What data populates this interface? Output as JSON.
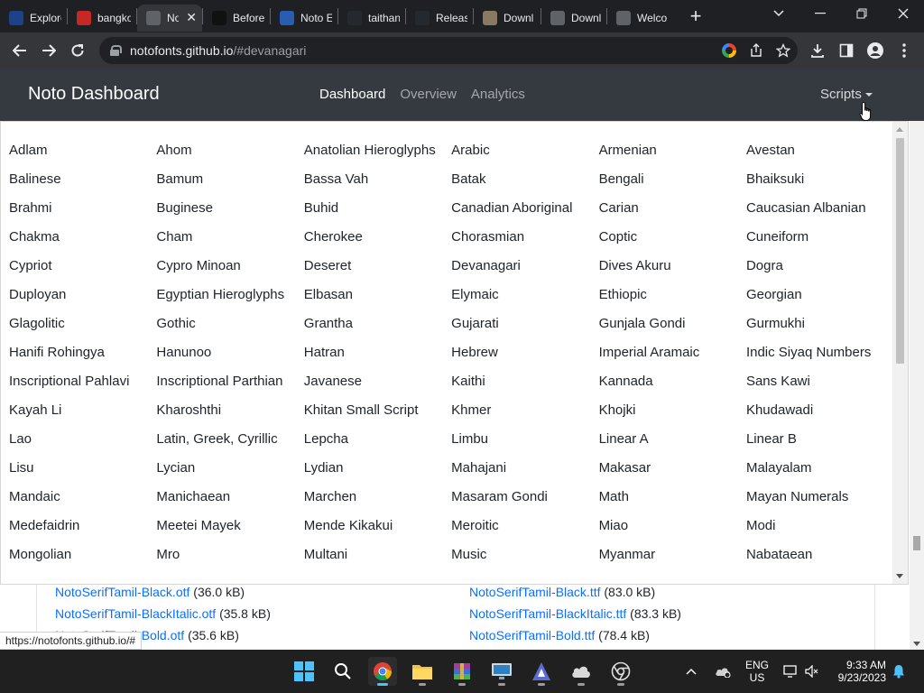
{
  "browser": {
    "tabs": [
      {
        "label": "Explore",
        "favicon": "vmware-icon",
        "color": "#1d428a"
      },
      {
        "label": "bangkok",
        "favicon": "bookmark-icon",
        "color": "#c62828"
      },
      {
        "label": "Noto",
        "favicon": "globe-icon",
        "color": "#5f6368",
        "active": true
      },
      {
        "label": "Before",
        "favicon": "shield-icon",
        "color": "#111111"
      },
      {
        "label": "Noto E",
        "favicon": "yahoo-icon",
        "color": "#2a5db0"
      },
      {
        "label": "taithan",
        "favicon": "github-icon",
        "color": "#24292f"
      },
      {
        "label": "Release",
        "favicon": "github-icon",
        "color": "#24292f"
      },
      {
        "label": "Downl",
        "favicon": "cloud-icon",
        "color": "#8a7a63"
      },
      {
        "label": "Downl",
        "favicon": "globe-icon",
        "color": "#5f6368"
      },
      {
        "label": "Welco",
        "favicon": "globe-icon",
        "color": "#5f6368"
      }
    ],
    "url_host": "notofonts.github.io",
    "url_path": "/#devanagari",
    "status_url": "https://notofonts.github.io/#"
  },
  "site": {
    "brand": "Noto Dashboard",
    "nav": [
      "Dashboard",
      "Overview",
      "Analytics"
    ],
    "active_nav": "Dashboard",
    "scripts_label": "Scripts"
  },
  "scripts": [
    "Adlam",
    "Ahom",
    "Anatolian Hieroglyphs",
    "Arabic",
    "Armenian",
    "Avestan",
    "Balinese",
    "Bamum",
    "Bassa Vah",
    "Batak",
    "Bengali",
    "Bhaiksuki",
    "Brahmi",
    "Buginese",
    "Buhid",
    "Canadian Aboriginal",
    "Carian",
    "Caucasian Albanian",
    "Chakma",
    "Cham",
    "Cherokee",
    "Chorasmian",
    "Coptic",
    "Cuneiform",
    "Cypriot",
    "Cypro Minoan",
    "Deseret",
    "Devanagari",
    "Dives Akuru",
    "Dogra",
    "Duployan",
    "Egyptian Hieroglyphs",
    "Elbasan",
    "Elymaic",
    "Ethiopic",
    "Georgian",
    "Glagolitic",
    "Gothic",
    "Grantha",
    "Gujarati",
    "Gunjala Gondi",
    "Gurmukhi",
    "Hanifi Rohingya",
    "Hanunoo",
    "Hatran",
    "Hebrew",
    "Imperial Aramaic",
    "Indic Siyaq Numbers",
    "Inscriptional Pahlavi",
    "Inscriptional Parthian",
    "Javanese",
    "Kaithi",
    "Kannada",
    "Sans Kawi",
    "Kayah Li",
    "Kharoshthi",
    "Khitan Small Script",
    "Khmer",
    "Khojki",
    "Khudawadi",
    "Lao",
    "Latin, Greek, Cyrillic",
    "Lepcha",
    "Limbu",
    "Linear A",
    "Linear B",
    "Lisu",
    "Lycian",
    "Lydian",
    "Mahajani",
    "Makasar",
    "Malayalam",
    "Mandaic",
    "Manichaean",
    "Marchen",
    "Masaram Gondi",
    "Math",
    "Mayan Numerals",
    "Medefaidrin",
    "Meetei Mayek",
    "Mende Kikakui",
    "Meroitic",
    "Miao",
    "Modi",
    "Mongolian",
    "Mro",
    "Multani",
    "Music",
    "Myanmar",
    "Nabataean"
  ],
  "files": [
    {
      "otf": "NotoSerifTamil-Black.otf",
      "otf_size": "(36.0 kB)",
      "ttf": "NotoSerifTamil-Black.ttf",
      "ttf_size": "(83.0 kB)"
    },
    {
      "otf": "NotoSerifTamil-BlackItalic.otf",
      "otf_size": "(35.8 kB)",
      "ttf": "NotoSerifTamil-BlackItalic.ttf",
      "ttf_size": "(83.3 kB)"
    },
    {
      "otf": "NotoSerifTamil-Bold.otf",
      "otf_size": "(35.6 kB)",
      "ttf": "NotoSerifTamil-Bold.ttf",
      "ttf_size": "(78.4 kB)"
    }
  ],
  "taskbar": {
    "lang_line1": "ENG",
    "lang_line2": "US",
    "time": "9:33 AM",
    "date": "9/23/2023"
  },
  "colors": {
    "navbar_bg": "#343a40",
    "link": "#0d6efd",
    "taskbar_bg": "#202020"
  }
}
